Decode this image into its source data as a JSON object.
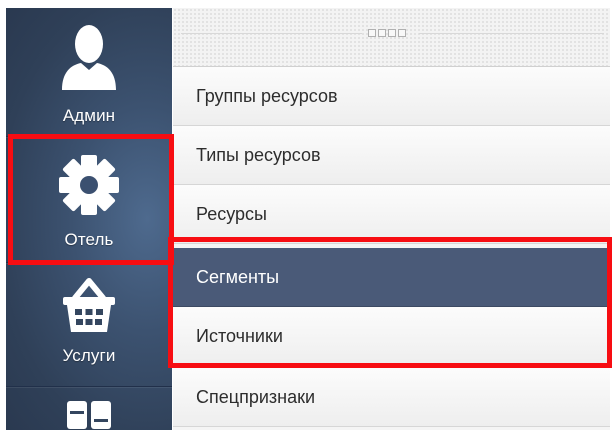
{
  "sidebar": {
    "items": [
      {
        "label": "Админ",
        "icon": "user-icon"
      },
      {
        "label": "Отель",
        "icon": "gear-icon"
      },
      {
        "label": "Услуги",
        "icon": "basket-icon"
      },
      {
        "label": "",
        "icon": "layout-icon"
      }
    ]
  },
  "menu": {
    "items": [
      {
        "label": "Группы ресурсов"
      },
      {
        "label": "Типы ресурсов"
      },
      {
        "label": "Ресурсы"
      },
      {
        "label": "Сегменты",
        "active": true
      },
      {
        "label": "Источники"
      },
      {
        "label": "Спецпризнаки"
      }
    ]
  },
  "colors": {
    "highlight": "#f70d12",
    "active_item": "#4a5a78",
    "sidebar": "#34465f"
  }
}
